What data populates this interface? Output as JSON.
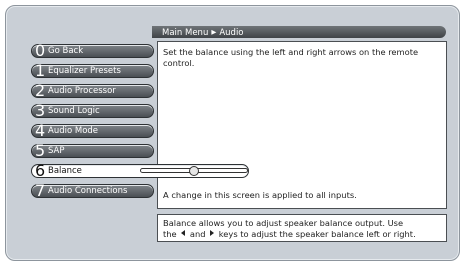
{
  "breadcrumb": {
    "parent": "Main Menu",
    "current": "Audio"
  },
  "content": {
    "description": "Set the balance using the left and right arrows on the remote control.",
    "note": "A change in this screen is applied to all inputs."
  },
  "help": {
    "line1": "Balance allows you to adjust speaker balance output. Use",
    "line2_prefix": "the",
    "line2_and": "and",
    "line2_suffix": "keys to adjust the speaker balance left or right."
  },
  "menu": [
    {
      "number": "0",
      "label": "Go Back"
    },
    {
      "number": "1",
      "label": "Equalizer Presets"
    },
    {
      "number": "2",
      "label": "Audio Processor"
    },
    {
      "number": "3",
      "label": "Sound Logic"
    },
    {
      "number": "4",
      "label": "Audio Mode"
    },
    {
      "number": "5",
      "label": "SAP"
    },
    {
      "number": "6",
      "label": "Balance"
    },
    {
      "number": "7",
      "label": "Audio Connections"
    }
  ],
  "balance": {
    "value": 0,
    "min": -50,
    "max": 50
  },
  "colors": {
    "background": "#c9cfd6",
    "menu_dark": "#4a4f54",
    "selected": "#ffffff"
  }
}
